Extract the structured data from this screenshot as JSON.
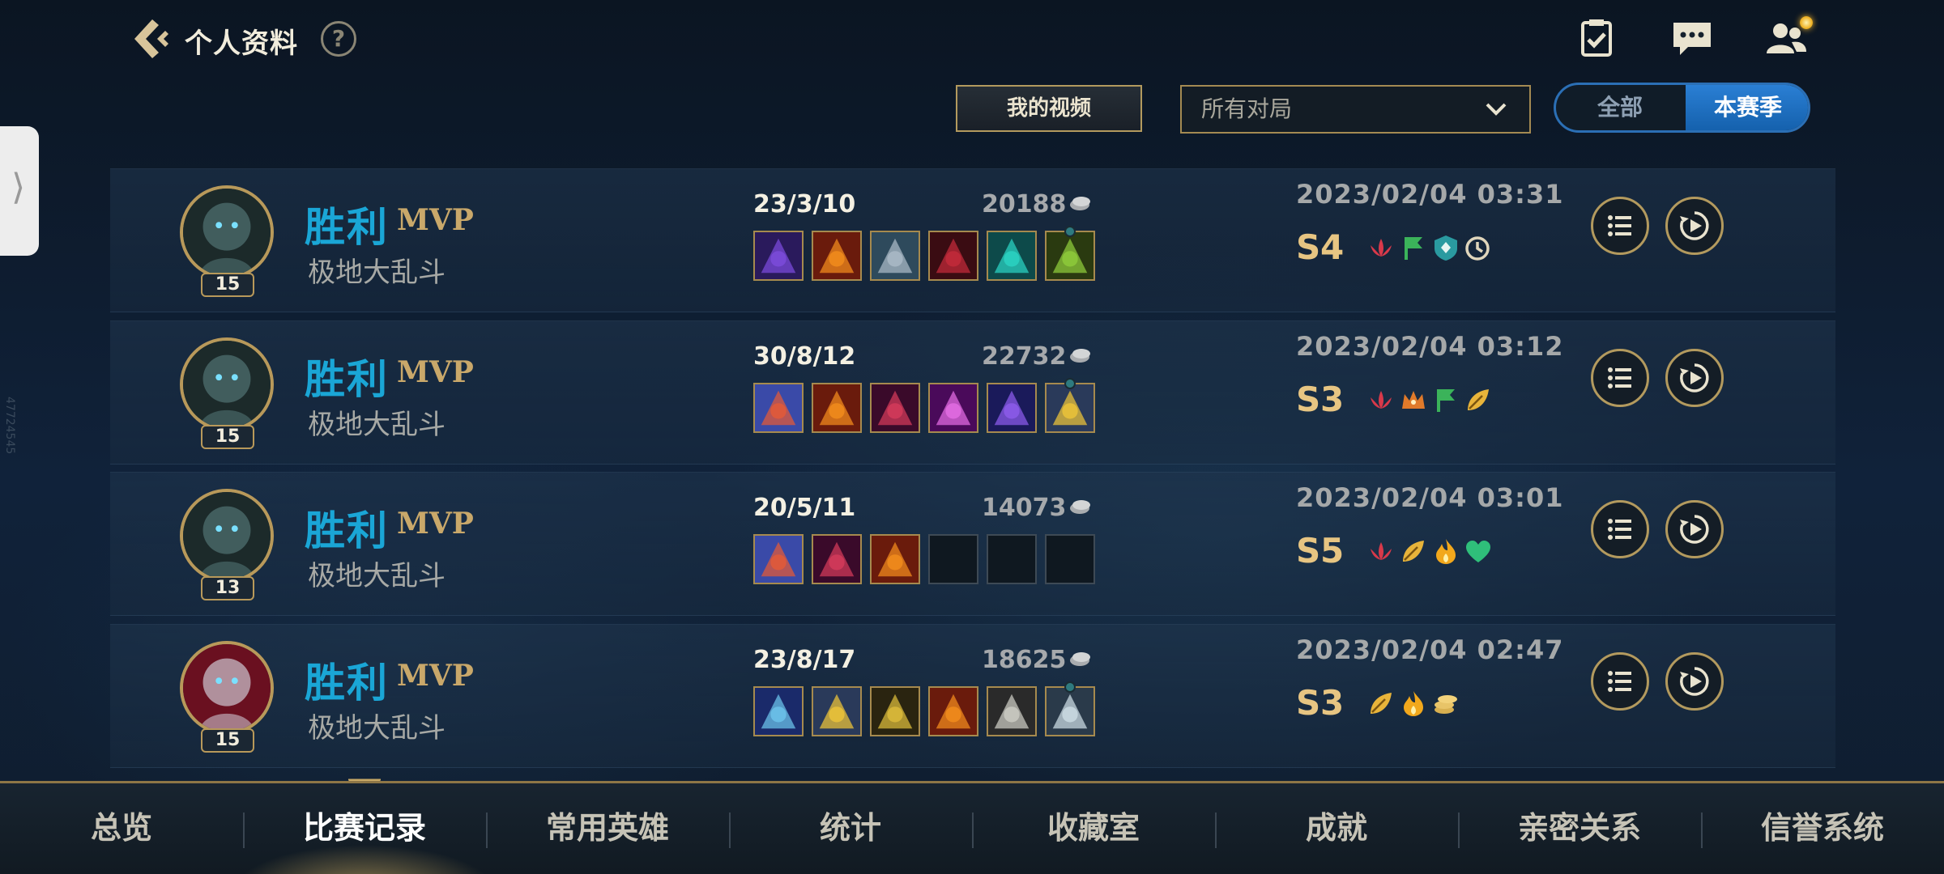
{
  "header": {
    "title": "个人资料",
    "help": "?"
  },
  "side": {
    "handle_glyph": "⟩",
    "id_text": "47724545"
  },
  "controls": {
    "my_video": "我的视频",
    "match_filter": {
      "value": "所有对局"
    },
    "season_toggle": {
      "all": "全部",
      "current": "本赛季",
      "selected": "本赛季"
    }
  },
  "matches": [
    {
      "result": "胜利",
      "mvp": "MVP",
      "mode": "极地大乱斗",
      "level": "15",
      "kda": "23/3/10",
      "gold": "20188",
      "date": "2023/02/04 03:31",
      "grade": "S",
      "rank_num": "4",
      "items": [
        "violet",
        "fire",
        "stone",
        "blood",
        "teal",
        "green"
      ],
      "badges": [
        "lotus-icon",
        "flag-icon",
        "shield-icon",
        "timer-icon"
      ]
    },
    {
      "result": "胜利",
      "mvp": "MVP",
      "mode": "极地大乱斗",
      "level": "15",
      "kda": "30/8/12",
      "gold": "22732",
      "date": "2023/02/04 03:12",
      "grade": "S",
      "rank_num": "3",
      "items": [
        "target",
        "fire",
        "crimson",
        "pink",
        "purple",
        "gold"
      ],
      "badges": [
        "lotus-icon",
        "crown-icon",
        "flag-icon",
        "leaf-icon"
      ]
    },
    {
      "result": "胜利",
      "mvp": "MVP",
      "mode": "极地大乱斗",
      "level": "13",
      "kda": "20/5/11",
      "gold": "14073",
      "date": "2023/02/04 03:01",
      "grade": "S",
      "rank_num": "5",
      "items": [
        "target",
        "crimson",
        "fire",
        "empty",
        "empty",
        "empty"
      ],
      "badges": [
        "lotus-icon",
        "leaf-icon",
        "flame-icon",
        "heart-icon"
      ]
    },
    {
      "result": "胜利",
      "mvp": "MVP",
      "mode": "极地大乱斗",
      "level": "15",
      "kda": "23/8/17",
      "gold": "18625",
      "date": "2023/02/04 02:47",
      "grade": "S",
      "rank_num": "3",
      "items": [
        "blue",
        "gold",
        "dagger",
        "fire",
        "sword",
        "armor"
      ],
      "badges": [
        "leaf-icon",
        "flame-icon",
        "coins-icon"
      ]
    }
  ],
  "nav": {
    "items": [
      "总览",
      "比赛记录",
      "常用英雄",
      "统计",
      "收藏室",
      "成就",
      "亲密关系",
      "信誉系统"
    ],
    "active": "比赛记录"
  },
  "colors": {
    "accent_gold": "#b8995a",
    "victory_blue": "#1aa6d6",
    "toggle_blue": "#2a7fd4"
  }
}
